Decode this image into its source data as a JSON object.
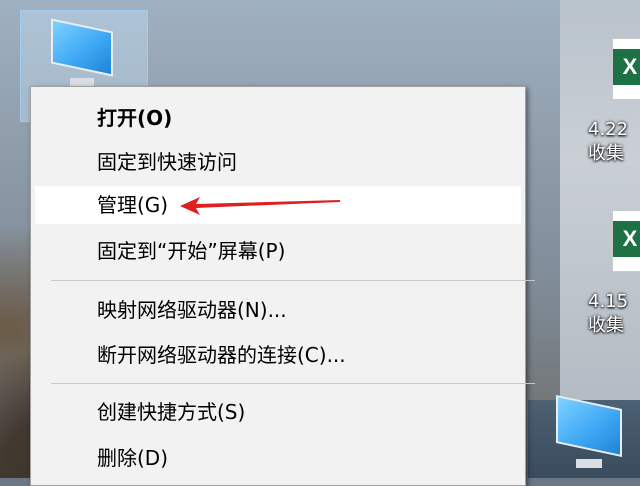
{
  "desktop": {
    "icons": [
      {
        "label_line1": "4.22",
        "label_line2": "收集"
      },
      {
        "label_line1": "4.15",
        "label_line2": "收集"
      }
    ]
  },
  "context_menu": {
    "items": [
      {
        "label": "打开(O)",
        "bold": true
      },
      {
        "label": "固定到快速访问"
      },
      {
        "label": "管理(G)",
        "highlighted": true
      },
      {
        "label": "固定到“开始”屏幕(P)"
      },
      {
        "label": "映射网络驱动器(N)..."
      },
      {
        "label": "断开网络驱动器的连接(C)..."
      },
      {
        "label": "创建快捷方式(S)"
      },
      {
        "label": "删除(D)"
      }
    ]
  },
  "annotation": {
    "arrow_color": "#e02020",
    "target": "管理(G)"
  },
  "colors": {
    "menu_bg": "#f2f2f2",
    "highlight_bg": "#ffffff",
    "excel_green": "#1e7145"
  }
}
